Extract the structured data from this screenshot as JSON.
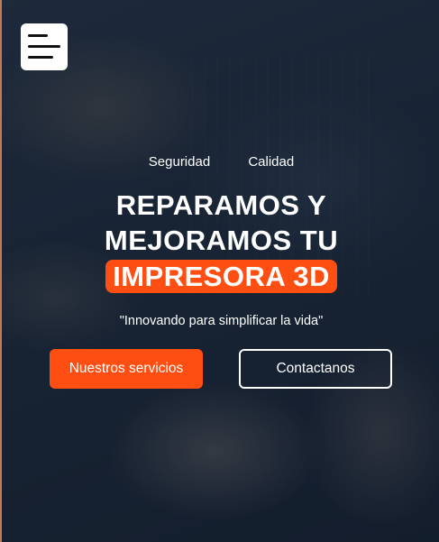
{
  "nav": {
    "menu_icon": "hamburger-menu-icon"
  },
  "tags": [
    "Seguridad",
    "Calidad"
  ],
  "headline": {
    "line1": "REPARAMOS Y",
    "line2": "MEJORAMOS TU",
    "highlight": "IMPRESORA 3D"
  },
  "tagline": "\"Innovando para simplificar la vida\"",
  "buttons": {
    "primary_label": "Nuestros servicios",
    "secondary_label": "Contactanos"
  },
  "colors": {
    "accent": "#ff4e12",
    "overlay": "#121e2e",
    "text": "#ffffff"
  }
}
